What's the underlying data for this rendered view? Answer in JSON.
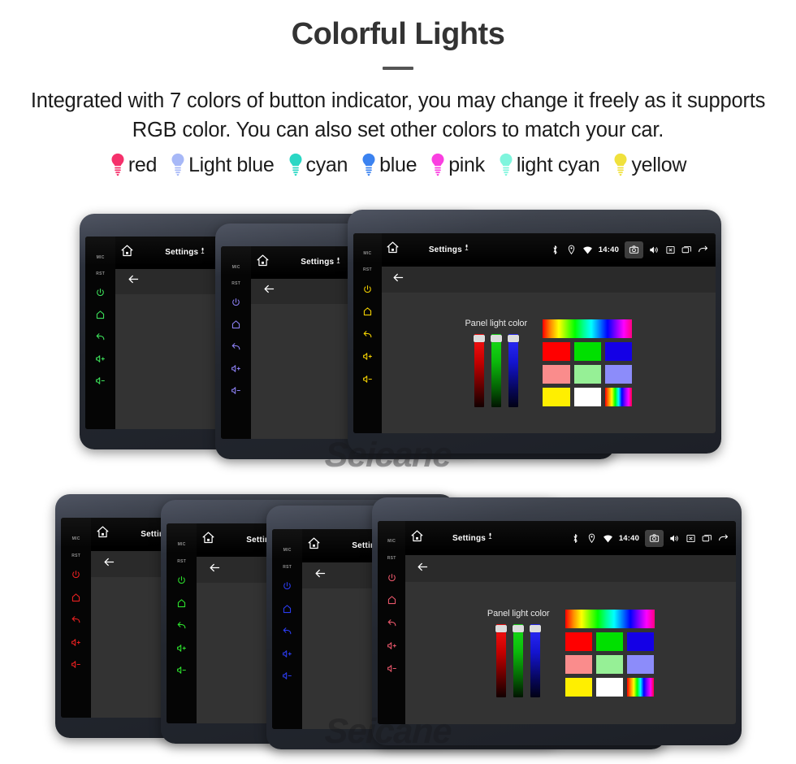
{
  "header": {
    "title": "Colorful Lights",
    "subtitle": "Integrated with 7 colors of button indicator, you may change it freely as it supports RGB color. You can also set other colors to match your car."
  },
  "legend": {
    "items": [
      {
        "label": "red",
        "color": "#f5316b",
        "icon": "bulb-icon"
      },
      {
        "label": "Light blue",
        "color": "#a7b8f7",
        "icon": "bulb-icon"
      },
      {
        "label": "cyan",
        "color": "#2ad7c4",
        "icon": "bulb-icon"
      },
      {
        "label": "blue",
        "color": "#3b82f0",
        "icon": "bulb-icon"
      },
      {
        "label": "pink",
        "color": "#fa3fe0",
        "icon": "bulb-icon"
      },
      {
        "label": "light cyan",
        "color": "#7ff5dd",
        "icon": "bulb-icon"
      },
      {
        "label": "yellow",
        "color": "#f0e13c",
        "icon": "bulb-icon"
      }
    ]
  },
  "device_ui": {
    "statusbar": {
      "home_icon": "home-icon",
      "title": "Settings",
      "mic_icon": "microphone-icon",
      "bluetooth_icon": "bluetooth-icon",
      "location_icon": "location-icon",
      "wifi_icon": "wifi-icon",
      "time": "14:40",
      "camera_icon": "camera-icon",
      "volume_icon": "volume-icon",
      "close_icon": "close-box-icon",
      "recents_icon": "recents-icon",
      "back_icon": "back-arrow-icon"
    },
    "appbar": {
      "back_icon": "back-arrow-icon"
    },
    "keystrip": {
      "mic_label": "MIC",
      "rst_label": "RST",
      "keys": [
        "power-icon",
        "home-icon",
        "back-icon",
        "volume-up-icon",
        "volume-down-icon"
      ]
    },
    "content": {
      "slider_caption": "Panel light color",
      "sliders": [
        {
          "name": "red-slider",
          "value": 95,
          "color": "#ff1414"
        },
        {
          "name": "green-slider",
          "value": 97,
          "color": "#19e219"
        },
        {
          "name": "blue-slider",
          "value": 96,
          "color": "#2d2dff"
        }
      ],
      "rainbow_bar": "rainbow-gradient",
      "swatch_rows": [
        [
          {
            "name": "swatch-red",
            "color": "#ff0000"
          },
          {
            "name": "swatch-green",
            "color": "#00e000"
          },
          {
            "name": "swatch-blue",
            "color": "#1400e6"
          }
        ],
        [
          {
            "name": "swatch-salmon",
            "color": "#fa8c8c"
          },
          {
            "name": "swatch-lightgreen",
            "color": "#96f096"
          },
          {
            "name": "swatch-periwinkle",
            "color": "#8c8cfa"
          }
        ],
        [
          {
            "name": "swatch-yellow",
            "color": "#ffef00"
          },
          {
            "name": "swatch-white",
            "color": "#ffffff"
          },
          {
            "name": "swatch-rainbow",
            "color": "rainbow"
          }
        ]
      ]
    }
  },
  "devices": {
    "top_row": [
      {
        "name": "device-top-green",
        "accent": "#3ce05a",
        "variant": "small"
      },
      {
        "name": "device-top-purple",
        "accent": "#8a7ef0",
        "variant": "small"
      },
      {
        "name": "device-top-yellow",
        "accent": "#f2d000",
        "variant": "large"
      }
    ],
    "bottom_row": [
      {
        "name": "device-bottom-red",
        "accent": "#e82020",
        "variant": "small"
      },
      {
        "name": "device-bottom-green",
        "accent": "#2ce02c",
        "variant": "small"
      },
      {
        "name": "device-bottom-blue",
        "accent": "#2b3cf0",
        "variant": "small"
      },
      {
        "name": "device-bottom-pink",
        "accent": "#e8566a",
        "variant": "large"
      }
    ]
  },
  "watermarks": [
    {
      "text": "Seicane",
      "name": "watermark-top"
    },
    {
      "text": "Seicane",
      "name": "watermark-bottom"
    }
  ]
}
